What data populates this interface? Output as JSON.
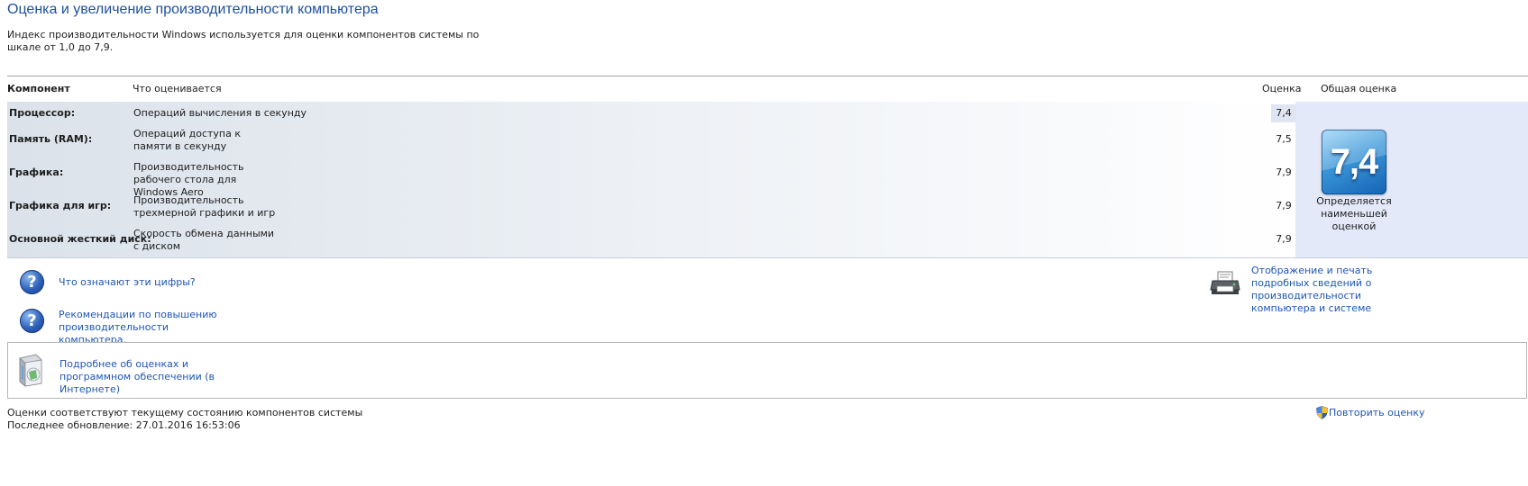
{
  "title": "Оценка и увеличение производительности компьютера",
  "description": "Индекс производительности Windows используется для оценки компонентов системы по шкале от 1,0 до 7,9.",
  "table": {
    "headers": {
      "component": "Компонент",
      "what": "Что оценивается",
      "score": "Оценка",
      "overall": "Общая оценка"
    },
    "rows": [
      {
        "component": "Процессор:",
        "what": "Операций вычисления в секунду",
        "score": "7,4"
      },
      {
        "component": "Память (RAM):",
        "what": "Операций доступа к памяти в секунду",
        "score": "7,5"
      },
      {
        "component": "Графика:",
        "what": "Производительность рабочего стола для Windows Aero",
        "score": "7,9"
      },
      {
        "component": "Графика для игр:",
        "what": "Производительность трехмерной графики и игр",
        "score": "7,9"
      },
      {
        "component": "Основной жесткий диск:",
        "what": "Скорость обмена данными с диском",
        "score": "7,9"
      }
    ],
    "overall_score": "7,4",
    "overall_note": "Определяется наименьшей оценкой"
  },
  "links": {
    "what_numbers_mean": "Что означают эти цифры?",
    "recommendations": "Рекомендации по повышению производительности компьютера.",
    "print_details": "Отображение и печать подробных сведений о производительности компьютера и системе",
    "more_info": "Подробнее об оценках и программном обеспечении (в Интернете)"
  },
  "status": {
    "line1": "Оценки соответствуют текущему состоянию компонентов системы",
    "line2": "Последнее обновление: 27.01.2016 16:53:06"
  },
  "rerun_label": "Повторить оценку",
  "icons": {
    "help": "question-mark-icon",
    "printer": "printer-icon",
    "software": "software-box-icon",
    "shield": "uac-shield-icon"
  },
  "colors": {
    "title": "#1e4f9c",
    "link": "#1e56b4",
    "badge": "#2f86d0"
  }
}
